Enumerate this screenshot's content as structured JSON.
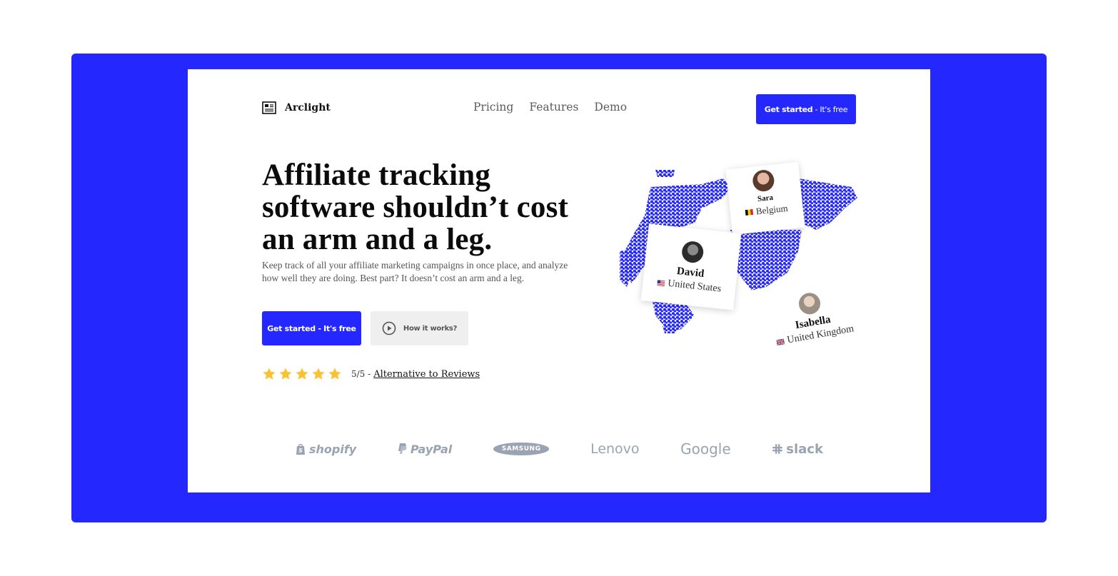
{
  "header": {
    "logo_text": "Arclight",
    "nav": [
      "Pricing",
      "Features",
      "Demo"
    ],
    "cta_bold": "Get started",
    "cta_light": " - It's free"
  },
  "hero": {
    "title": "Affiliate tracking software shouldn’t cost an arm and a leg.",
    "subtitle": "Keep track of all your affiliate marketing campaigns in once place, and analyze how well they are doing. Best part? It doesn’t cost an arm and a leg.",
    "primary_button": "Get started - It's free",
    "secondary_button": "How it works?",
    "rating_score": "5/5 -",
    "rating_link": "Alternative to Reviews",
    "stars": 5
  },
  "map": {
    "users": [
      {
        "name": "Sara",
        "country": "Belgium"
      },
      {
        "name": "David",
        "country": "United States"
      },
      {
        "name": "Isabella",
        "country": "United Kingdom"
      }
    ]
  },
  "brands": [
    "shopify",
    "PayPal",
    "SAMSUNG",
    "Lenovo",
    "Google",
    "slack"
  ],
  "colors": {
    "accent": "#2528fe",
    "star": "#f9c22e",
    "brand_gray": "#9aa3b1"
  }
}
